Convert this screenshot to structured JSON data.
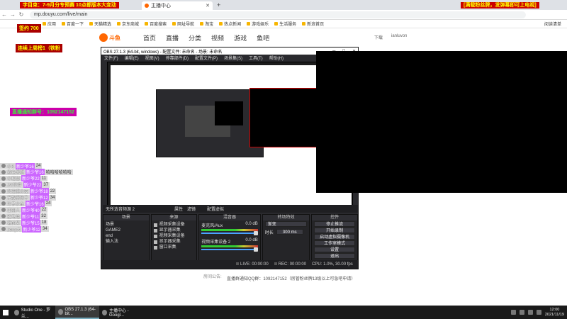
{
  "browser": {
    "tab_title": "主播中心",
    "url": "mp.douyu.com/live/main",
    "bookmarks": [
      "应用",
      "百度一下",
      "天猫精选",
      "京东商城",
      "百度搜索",
      "网址导航",
      "淘宝",
      "热点新闻",
      "游戏娱乐",
      "生活服务",
      "新浪首页"
    ],
    "reading_list": "阅读清单"
  },
  "overlay": {
    "banner_left": "字目束：7-9月分专预赛 10点都版本大变动",
    "banner_right": "[满载粉丝牌，发弹幕即可上电视]",
    "exp_label": "签约 700",
    "rank_label": "连续上周榜1（铁粉",
    "qq_notice": "直播通知群号：1092147152"
  },
  "danmu": [
    {
      "name": "小K",
      "level": "新少爷16",
      "text": "24"
    },
    {
      "name": "紫色冰糖",
      "level": "新少爷16",
      "text": "哈哈哈哈哈哈"
    },
    {
      "name": "小松鼠",
      "level": "新少爷22",
      "text": "11"
    },
    {
      "name": "JW伙伴",
      "level": "新少爷22",
      "text": "37"
    },
    {
      "name": "炎浩熊小皮",
      "level": "新少爷18",
      "text": "22"
    },
    {
      "name": "无敌熊孩子",
      "level": "新少爷12",
      "text": "34"
    },
    {
      "name": "叶子小东",
      "level": "新少爷16",
      "text": "24"
    },
    {
      "name": "亚洲人",
      "level": "新少爷40",
      "text": "22"
    },
    {
      "name": "雅马哈",
      "level": "新少爷11",
      "text": "32"
    },
    {
      "name": "灌的某",
      "level": "新少爷15",
      "text": "18"
    },
    {
      "name": "Jerry大",
      "level": "新少爷12",
      "text": "34"
    }
  ],
  "douyu": {
    "logo": "斗鱼",
    "nav": [
      "首页",
      "直播",
      "分类",
      "视频",
      "游戏",
      "鱼吧"
    ],
    "download": "下载",
    "username": "ianluvon"
  },
  "obs": {
    "title": "OBS 27.1.3 (64-bit, windows) - 配置文件: 未命名 - 场景: 未命名",
    "menu": [
      "文件(F)",
      "编辑(E)",
      "视图(V)",
      "停靠部件(D)",
      "配置文件(P)",
      "场景集(S)",
      "工具(T)",
      "帮助(H)"
    ],
    "source_label": "无所选音频源 2",
    "props_btn": "属性",
    "filter_btn": "滤镜",
    "vcam_btn": "配置虚拟",
    "dock_scenes": "场景",
    "dock_sources": "来源",
    "dock_mixer": "混音器",
    "dock_transitions": "转场特效",
    "dock_controls": "控件",
    "scenes": [
      "场景",
      "GAME2",
      "end",
      "输入法"
    ],
    "sources": [
      "视频采集设备",
      "显示器采集",
      "视频采集设备",
      "显示器采集",
      "窗口采集"
    ],
    "mixer": [
      {
        "name": "麦克风/Aux",
        "db": "0.0 dB"
      },
      {
        "name": "视频采集设备 2",
        "db": "0.0 dB"
      }
    ],
    "transition": "渐变",
    "duration_label": "时长",
    "duration_value": "300 ms",
    "controls": [
      "停止推流",
      "开始录制",
      "启动虚拟摄像机",
      "工作室模式",
      "设置",
      "退出"
    ],
    "status": {
      "live": "LIVE: 00:00:00",
      "rec": "REC: 00:00:00",
      "cpu": "CPU: 1.0%, 30.00 fps"
    }
  },
  "page_bottom": {
    "notice_label": "房间公告:",
    "notice": "直播群通知QQ群：1092147152（房管粉丝牌13级以上可急吧申请）"
  },
  "taskbar": {
    "items": [
      "Studio One - 罗兰...",
      "OBS 27.1.3 (64-bit...",
      "主播中心 - Googl..."
    ],
    "time": "12:00",
    "date": "2021/11/19"
  }
}
